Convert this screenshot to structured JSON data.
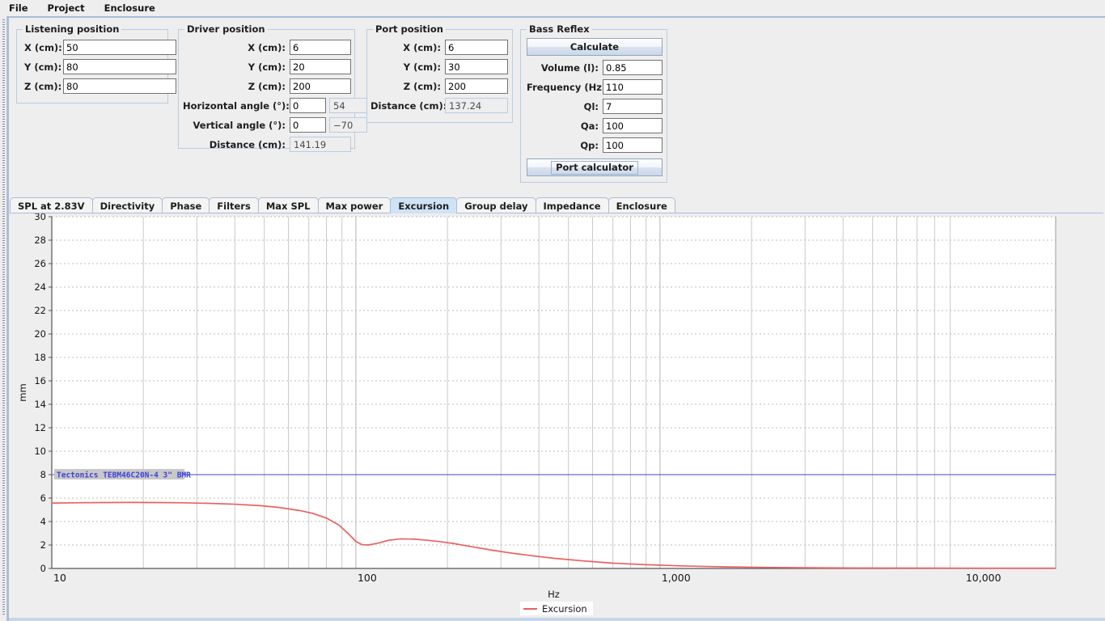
{
  "menubar": {
    "items": [
      {
        "label": "File"
      },
      {
        "label": "Project"
      },
      {
        "label": "Enclosure"
      }
    ]
  },
  "panels": {
    "listening_position": {
      "title": "Listening position",
      "fields": [
        {
          "label": "X (cm):",
          "value": "50"
        },
        {
          "label": "Y (cm):",
          "value": "80"
        },
        {
          "label": "Z (cm):",
          "value": "80"
        }
      ]
    },
    "driver_position": {
      "title": "Driver position",
      "fields": [
        {
          "label": "X (cm):",
          "value": "6"
        },
        {
          "label": "Y (cm):",
          "value": "20"
        },
        {
          "label": "Z (cm):",
          "value": "200"
        },
        {
          "label": "Horizontal angle (°):",
          "value": "0",
          "readonly_value": "54"
        },
        {
          "label": "Vertical angle (°):",
          "value": "0",
          "readonly_value": "−70"
        },
        {
          "label": "Distance (cm):",
          "readonly_value": "141.19"
        }
      ]
    },
    "port_position": {
      "title": "Port position",
      "fields": [
        {
          "label": "X (cm):",
          "value": "6"
        },
        {
          "label": "Y (cm):",
          "value": "30"
        },
        {
          "label": "Z (cm):",
          "value": "200"
        },
        {
          "label": "Distance (cm):",
          "readonly_value": "137.24"
        }
      ]
    },
    "bass_reflex": {
      "title": "Bass Reflex",
      "calculate_label": "Calculate",
      "port_calculator_label": "Port calculator",
      "fields": [
        {
          "label": "Volume (l):",
          "value": "0.85"
        },
        {
          "label": "Frequency (Hz):",
          "value": "110"
        },
        {
          "label": "Ql:",
          "value": "7"
        },
        {
          "label": "Qa:",
          "value": "100"
        },
        {
          "label": "Qp:",
          "value": "100"
        }
      ]
    }
  },
  "tabs": {
    "items": [
      {
        "label": "SPL at 2.83V",
        "active": false
      },
      {
        "label": "Directivity",
        "active": false
      },
      {
        "label": "Phase",
        "active": false
      },
      {
        "label": "Filters",
        "active": false
      },
      {
        "label": "Max SPL",
        "active": false
      },
      {
        "label": "Max power",
        "active": false
      },
      {
        "label": "Excursion",
        "active": true
      },
      {
        "label": "Group delay",
        "active": false
      },
      {
        "label": "Impedance",
        "active": false
      },
      {
        "label": "Enclosure",
        "active": false
      }
    ],
    "active_label": "Excursion"
  },
  "legend": {
    "entries": [
      {
        "label": "Excursion",
        "color": "#e8625e"
      }
    ]
  },
  "colors": {
    "curve": "#e8625e",
    "annotation": "#4040d8",
    "grid_major": "#b4b4b4",
    "grid_minor": "#c9c9c9",
    "axis": "#555555",
    "panel_bg": "#eeeeee",
    "plot_bg": "#ffffff",
    "tab_active": "#cfe3f7",
    "border": "#a8bcd8"
  },
  "chart_data": {
    "type": "line",
    "title": "",
    "xlabel": "Hz",
    "ylabel": "mm",
    "xscale": "log",
    "xlim": [
      10,
      20000
    ],
    "ylim": [
      0,
      30
    ],
    "xticks": [
      10,
      100,
      1000,
      10000
    ],
    "xticklabels": [
      "10",
      "100",
      "1,000",
      "10,000"
    ],
    "yticks": [
      0,
      2,
      4,
      6,
      8,
      10,
      12,
      14,
      16,
      18,
      20,
      22,
      24,
      26,
      28,
      30
    ],
    "grid": true,
    "legend_position": "bottom",
    "annotations": [
      {
        "text": "Tectonics TEBM46C20N-4 3\" BMR",
        "x": 10,
        "y": 8,
        "color": "#4040d8"
      }
    ],
    "series": [
      {
        "name": "Excursion",
        "color": "#e8625e",
        "x": [
          10,
          12,
          15,
          18,
          22,
          27,
          33,
          40,
          48,
          56,
          65,
          72,
          80,
          88,
          95,
          100,
          105,
          110,
          118,
          128,
          140,
          155,
          170,
          190,
          210,
          240,
          280,
          320,
          380,
          450,
          550,
          700,
          900,
          1200,
          1600,
          2200,
          3000,
          4500,
          7000,
          11000,
          20000
        ],
        "y": [
          5.58,
          5.6,
          5.62,
          5.63,
          5.62,
          5.6,
          5.55,
          5.48,
          5.36,
          5.2,
          4.95,
          4.7,
          4.3,
          3.7,
          2.9,
          2.3,
          2.02,
          2.0,
          2.15,
          2.4,
          2.52,
          2.5,
          2.42,
          2.28,
          2.12,
          1.86,
          1.56,
          1.33,
          1.08,
          0.86,
          0.66,
          0.45,
          0.32,
          0.21,
          0.14,
          0.09,
          0.06,
          0.04,
          0.03,
          0.02,
          0.02
        ]
      }
    ]
  }
}
